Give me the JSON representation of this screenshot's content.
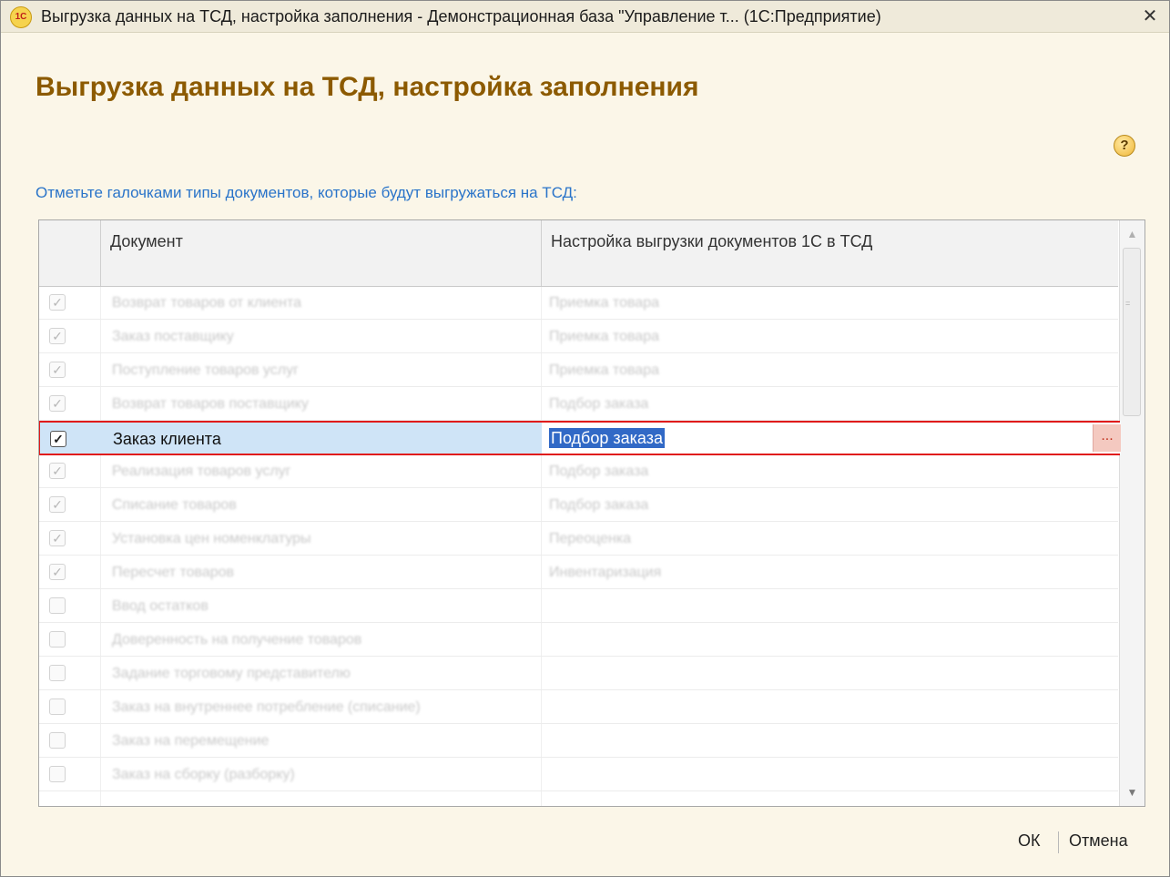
{
  "window": {
    "title": "Выгрузка данных на ТСД, настройка заполнения - Демонстрационная база \"Управление т... (1С:Предприятие)",
    "logo_text": "1С",
    "close_glyph": "✕"
  },
  "form": {
    "title": "Выгрузка данных на ТСД, настройка заполнения",
    "help_glyph": "?",
    "hint": "Отметьте галочками типы документов, которые будут выгружаться на ТСД:"
  },
  "table": {
    "columns": [
      "Документ",
      "Настройка выгрузки документов 1С в ТСД"
    ],
    "rows": [
      {
        "checked": true,
        "document": "Возврат товаров от клиента",
        "setting": "Приемка товара"
      },
      {
        "checked": true,
        "document": "Заказ поставщику",
        "setting": "Приемка товара"
      },
      {
        "checked": true,
        "document": "Поступление товаров услуг",
        "setting": "Приемка товара"
      },
      {
        "checked": true,
        "document": "Возврат товаров поставщику",
        "setting": "Подбор заказа"
      },
      {
        "checked": true,
        "document": "Заказ клиента",
        "setting": "Подбор заказа",
        "selected": true
      },
      {
        "checked": true,
        "document": "Реализация товаров услуг",
        "setting": "Подбор заказа"
      },
      {
        "checked": true,
        "document": "Списание товаров",
        "setting": "Подбор заказа"
      },
      {
        "checked": true,
        "document": "Установка цен номенклатуры",
        "setting": "Переоценка"
      },
      {
        "checked": true,
        "document": "Пересчет товаров",
        "setting": "Инвентаризация"
      },
      {
        "checked": false,
        "document": "Ввод остатков",
        "setting": ""
      },
      {
        "checked": false,
        "document": "Доверенность на получение товаров",
        "setting": ""
      },
      {
        "checked": false,
        "document": "Задание торговому представителю",
        "setting": ""
      },
      {
        "checked": false,
        "document": "Заказ на внутреннее потребление (списание)",
        "setting": ""
      },
      {
        "checked": false,
        "document": "Заказ на перемещение",
        "setting": ""
      },
      {
        "checked": false,
        "document": "Заказ на сборку (разборку)",
        "setting": ""
      }
    ],
    "select_button": "...",
    "checkmark": "✓"
  },
  "scrollbar": {
    "up": "▲",
    "down": "▼",
    "grip": "="
  },
  "buttons": {
    "ok": "ОК",
    "cancel": "Отмена"
  }
}
